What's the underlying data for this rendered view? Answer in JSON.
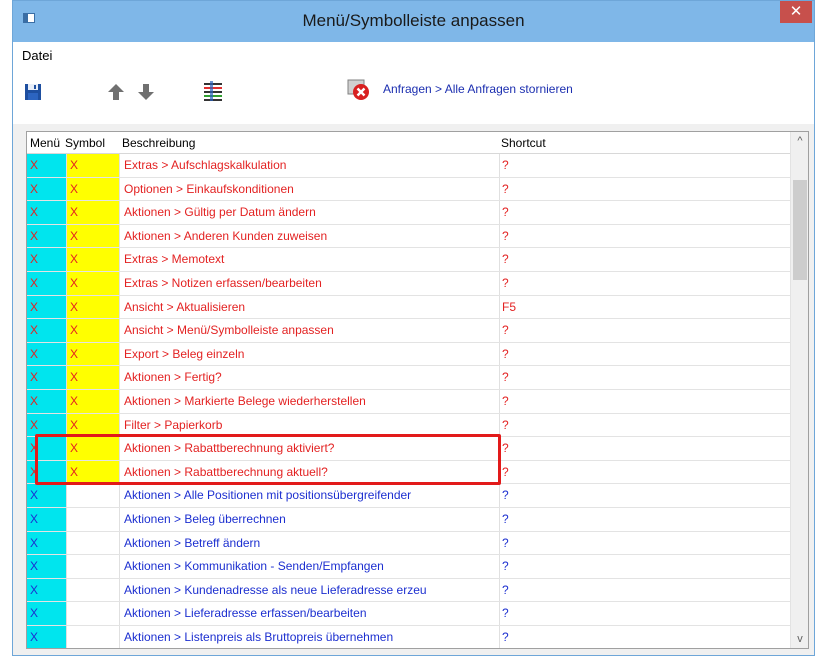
{
  "window": {
    "title": "Menü/Symbolleiste anpassen",
    "close_glyph": "✕"
  },
  "menubar": {
    "datei": "Datei"
  },
  "toolbar": {
    "icons": [
      "save-icon",
      "arrow-up-icon",
      "arrow-down-icon",
      "configure-icon",
      "cancel-requests-icon"
    ],
    "cancel_label": "Anfragen > Alle Anfragen stornieren"
  },
  "grid": {
    "headers": {
      "menu": "Menü",
      "symbol": "Symbol",
      "desc": "Beschreibung",
      "shortcut": "Shortcut"
    },
    "rows": [
      {
        "menu": "X",
        "symbol": "X",
        "desc": "Extras > Aufschlagskalkulation",
        "shortcut": "?",
        "color": "red"
      },
      {
        "menu": "X",
        "symbol": "X",
        "desc": "Optionen > Einkaufskonditionen",
        "shortcut": "?",
        "color": "red"
      },
      {
        "menu": "X",
        "symbol": "X",
        "desc": "Aktionen > Gültig per Datum ändern",
        "shortcut": "?",
        "color": "red"
      },
      {
        "menu": "X",
        "symbol": "X",
        "desc": "Aktionen > Anderen Kunden zuweisen",
        "shortcut": "?",
        "color": "red"
      },
      {
        "menu": "X",
        "symbol": "X",
        "desc": "Extras > Memotext",
        "shortcut": "?",
        "color": "red"
      },
      {
        "menu": "X",
        "symbol": "X",
        "desc": "Extras > Notizen erfassen/bearbeiten",
        "shortcut": "?",
        "color": "red"
      },
      {
        "menu": "X",
        "symbol": "X",
        "desc": "Ansicht > Aktualisieren",
        "shortcut": "F5",
        "color": "red"
      },
      {
        "menu": "X",
        "symbol": "X",
        "desc": "Ansicht > Menü/Symbolleiste anpassen",
        "shortcut": "?",
        "color": "red"
      },
      {
        "menu": "X",
        "symbol": "X",
        "desc": "Export > Beleg einzeln",
        "shortcut": "?",
        "color": "red"
      },
      {
        "menu": "X",
        "symbol": "X",
        "desc": "Aktionen > Fertig?",
        "shortcut": "?",
        "color": "red"
      },
      {
        "menu": "X",
        "symbol": "X",
        "desc": "Aktionen > Markierte Belege wiederherstellen",
        "shortcut": "?",
        "color": "red"
      },
      {
        "menu": "X",
        "symbol": "X",
        "desc": "Filter > Papierkorb",
        "shortcut": "?",
        "color": "red"
      },
      {
        "menu": "X",
        "symbol": "X",
        "desc": "Aktionen > Rabattberechnung aktiviert?",
        "shortcut": "?",
        "color": "red"
      },
      {
        "menu": "X",
        "symbol": "X",
        "desc": "Aktionen > Rabattberechnung aktuell?",
        "shortcut": "?",
        "color": "red"
      },
      {
        "menu": "X",
        "symbol": "",
        "desc": "Aktionen > Alle Positionen mit positionsübergreifender",
        "shortcut": "?",
        "color": "blue"
      },
      {
        "menu": "X",
        "symbol": "",
        "desc": "Aktionen > Beleg überrechnen",
        "shortcut": "?",
        "color": "blue"
      },
      {
        "menu": "X",
        "symbol": "",
        "desc": "Aktionen > Betreff ändern",
        "shortcut": "?",
        "color": "blue"
      },
      {
        "menu": "X",
        "symbol": "",
        "desc": "Aktionen > Kommunikation - Senden/Empfangen",
        "shortcut": "?",
        "color": "blue"
      },
      {
        "menu": "X",
        "symbol": "",
        "desc": "Aktionen > Kundenadresse als neue Lieferadresse erzeu",
        "shortcut": "?",
        "color": "blue"
      },
      {
        "menu": "X",
        "symbol": "",
        "desc": "Aktionen > Lieferadresse erfassen/bearbeiten",
        "shortcut": "?",
        "color": "blue"
      },
      {
        "menu": "X",
        "symbol": "",
        "desc": "Aktionen > Listenpreis als Bruttopreis übernehmen",
        "shortcut": "?",
        "color": "blue"
      }
    ]
  },
  "scrollbar": {
    "up_glyph": "^",
    "down_glyph": "v"
  },
  "colors": {
    "menu_cell": "#00e5ee",
    "symbol_cell": "#ffff00",
    "red_text": "#e32222",
    "blue_text": "#1c2fd0",
    "highlight": "#e21a1a"
  }
}
